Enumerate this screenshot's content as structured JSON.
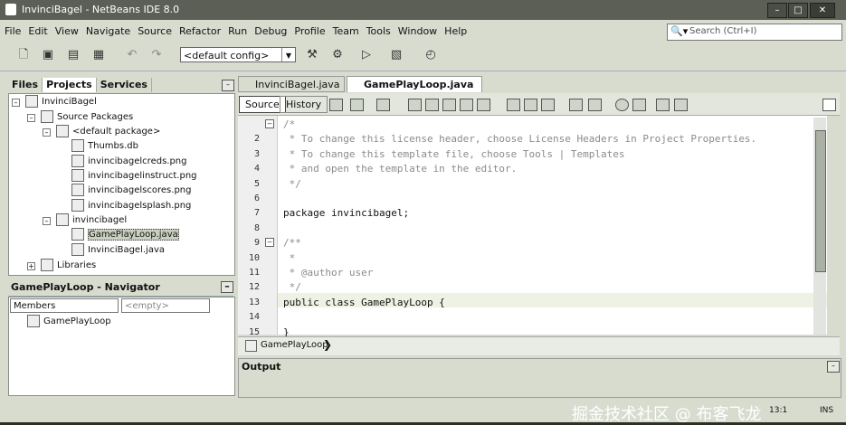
{
  "window": {
    "title": "InvinciBagel - NetBeans IDE 8.0",
    "min_symbol": "–",
    "max_symbol": "□",
    "close_symbol": "✕"
  },
  "menu": [
    "File",
    "Edit",
    "View",
    "Navigate",
    "Source",
    "Refactor",
    "Run",
    "Debug",
    "Profile",
    "Team",
    "Tools",
    "Window",
    "Help"
  ],
  "search": {
    "placeholder": "Search (Ctrl+I)",
    "icon": "search-icon"
  },
  "toolbar": {
    "config_value": "<default config>",
    "icons": [
      "new-file-icon",
      "new-project-icon",
      "open-project-icon",
      "save-all-icon",
      "undo-icon",
      "redo-icon",
      "clean-build-icon",
      "build-icon",
      "run-icon",
      "debug-icon",
      "profile-icon"
    ]
  },
  "project_panel": {
    "tabs": [
      "Files",
      "Projects",
      "Services"
    ],
    "active_tab": "Projects",
    "tree": [
      {
        "label": "InvinciBagel",
        "level": 0,
        "icon": "project-icon"
      },
      {
        "label": "Source Packages",
        "level": 1,
        "icon": "package-folder-icon"
      },
      {
        "label": "<default package>",
        "level": 2,
        "icon": "package-icon"
      },
      {
        "label": "Thumbs.db",
        "level": 3,
        "icon": "file-icon"
      },
      {
        "label": "invincibagelcreds.png",
        "level": 3,
        "icon": "image-file-icon"
      },
      {
        "label": "invincibagelinstruct.png",
        "level": 3,
        "icon": "image-file-icon"
      },
      {
        "label": "invincibagelscores.png",
        "level": 3,
        "icon": "image-file-icon"
      },
      {
        "label": "invincibagelsplash.png",
        "level": 3,
        "icon": "image-file-icon"
      },
      {
        "label": "invincibagel",
        "level": 2,
        "icon": "package-icon"
      },
      {
        "label": "GamePlayLoop.java",
        "level": 3,
        "icon": "java-file-icon",
        "selected": true
      },
      {
        "label": "InvinciBagel.java",
        "level": 3,
        "icon": "java-file-icon"
      },
      {
        "label": "Libraries",
        "level": 1,
        "icon": "library-icon"
      }
    ]
  },
  "navigator": {
    "title": "GamePlayLoop - Navigator",
    "members_value": "Members",
    "filter_value": "<empty>",
    "items": [
      "GamePlayLoop"
    ]
  },
  "editor": {
    "tabs": [
      {
        "label": "InvinciBagel.java",
        "active": false
      },
      {
        "label": "GamePlayLoop.java",
        "active": true
      }
    ],
    "mode_buttons": [
      "Source",
      "History"
    ],
    "active_mode": "Source",
    "lines": [
      {
        "num": "",
        "text": "/*",
        "type": "comment"
      },
      {
        "num": "2",
        "text": " * To change this license header, choose License Headers in Project Properties.",
        "type": "comment"
      },
      {
        "num": "3",
        "text": " * To change this template file, choose Tools | Templates",
        "type": "comment"
      },
      {
        "num": "4",
        "text": " * and open the template in the editor.",
        "type": "comment"
      },
      {
        "num": "5",
        "text": " */",
        "type": "comment"
      },
      {
        "num": "6",
        "text": "",
        "type": "code"
      },
      {
        "num": "7",
        "text": "package invincibagel;",
        "type": "code"
      },
      {
        "num": "8",
        "text": "",
        "type": "code"
      },
      {
        "num": "9",
        "text": "/**",
        "type": "comment"
      },
      {
        "num": "10",
        "text": " *",
        "type": "comment"
      },
      {
        "num": "11",
        "text": " * @author user",
        "type": "comment"
      },
      {
        "num": "12",
        "text": " */",
        "type": "comment"
      },
      {
        "num": "13",
        "text": "public class GamePlayLoop {",
        "type": "code"
      },
      {
        "num": "14",
        "text": "",
        "type": "code"
      },
      {
        "num": "15",
        "text": "}",
        "type": "code"
      }
    ],
    "breadcrumb": "GamePlayLoop"
  },
  "output": {
    "title": "Output"
  },
  "status": {
    "position": "13:1",
    "mode": "INS"
  },
  "watermark": "掘金技术社区 @ 布客飞龙"
}
